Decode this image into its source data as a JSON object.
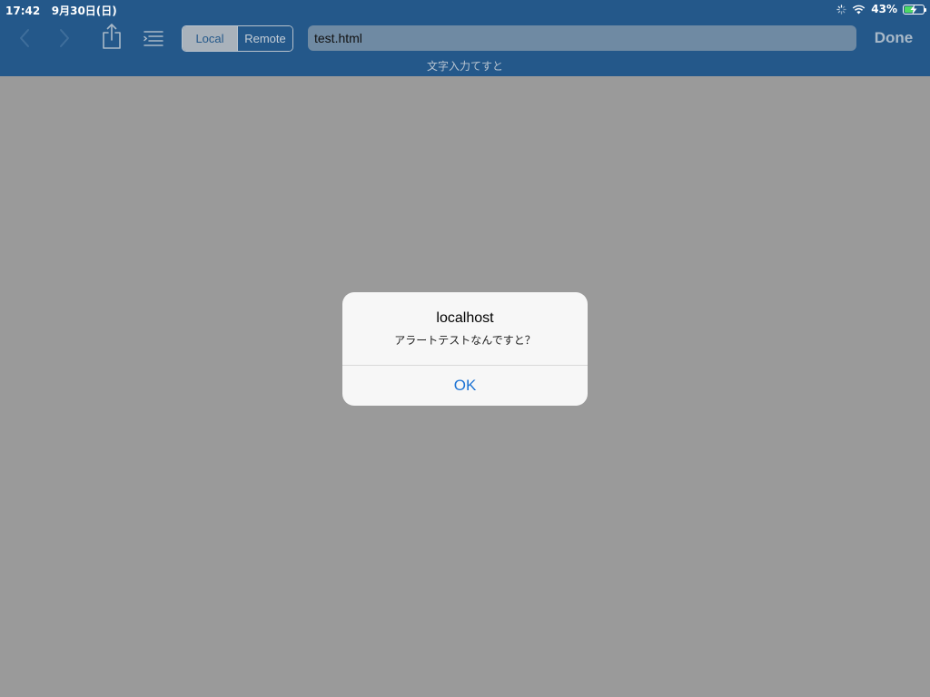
{
  "status_bar": {
    "time": "17:42",
    "date": "9月30日(日)",
    "battery_text": "43%",
    "battery_level": 0.43,
    "battery_fill_color": "#4cd964"
  },
  "toolbar": {
    "back_icon": "chevron-left-icon",
    "forward_icon": "chevron-right-icon",
    "share_icon": "share-icon",
    "list_icon": "list-icon",
    "segments": [
      "Local",
      "Remote"
    ],
    "selected_segment": "Local",
    "url_value": "test.html",
    "done_label": "Done",
    "subtitle": "文字入力てすと",
    "bar_color": "#24588a"
  },
  "alert": {
    "title": "localhost",
    "message": "アラートテストなんですと？",
    "ok_label": "OK",
    "button_color": "#1d73d4"
  },
  "colors": {
    "dimmed_background": "#9a9a9a"
  }
}
